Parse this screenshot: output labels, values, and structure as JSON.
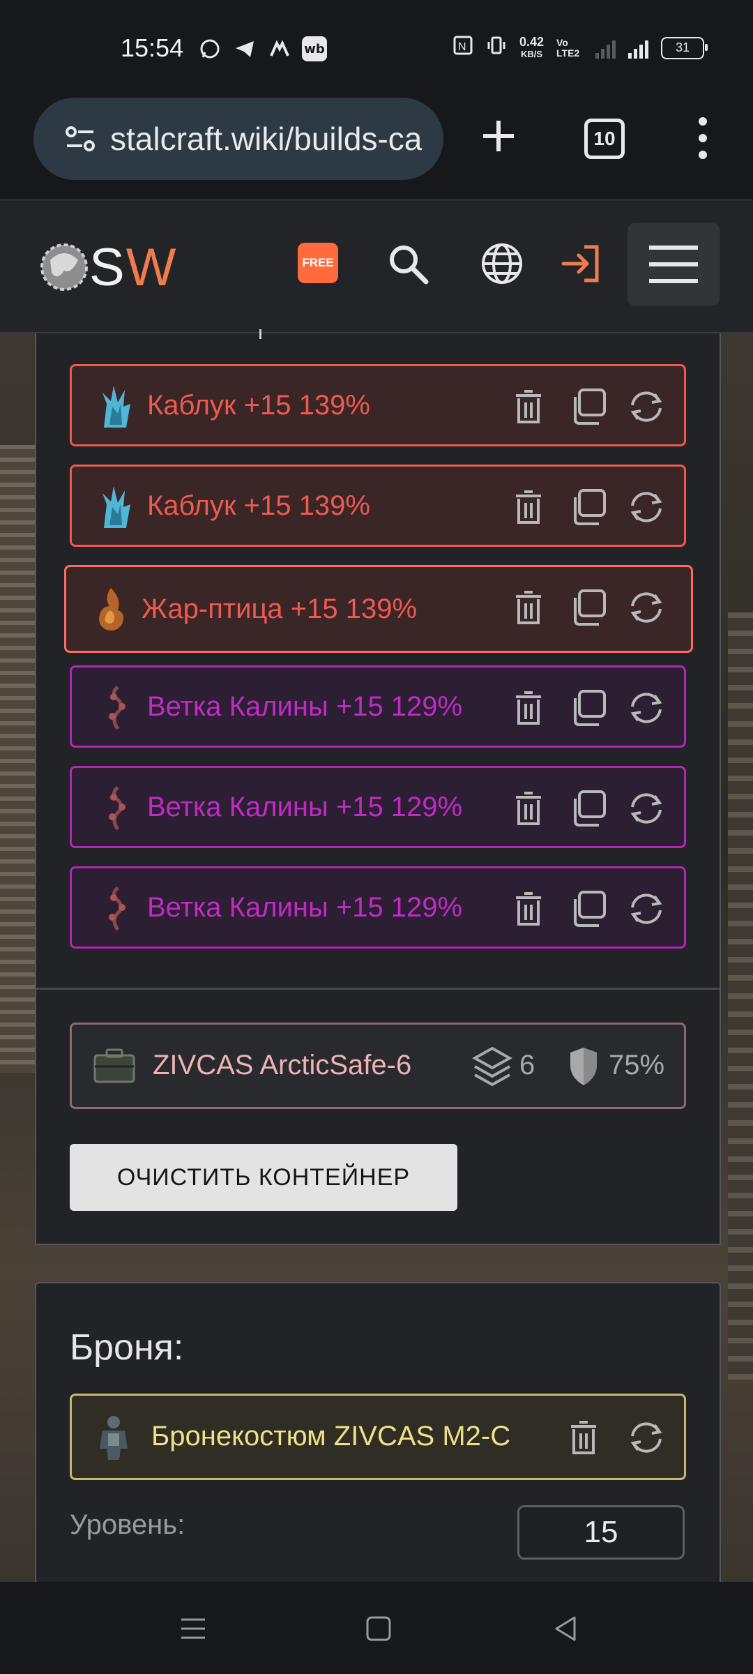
{
  "status_bar": {
    "time": "15:54",
    "apps": [
      "whatsapp-icon",
      "telegram-icon",
      "app-icon",
      "wb"
    ],
    "net_speed_value": "0.42",
    "net_speed_unit": "KB/S",
    "volte": "Vo LTE2",
    "battery": "31"
  },
  "browser": {
    "url": "stalcraft.wiki/builds-ca",
    "tab_count": "10"
  },
  "site": {
    "logo_s": "S",
    "logo_w": "W",
    "free_badge": "FREE"
  },
  "artifacts": [
    {
      "name": "Каблук +15 139%",
      "rarity": "red",
      "icon": "crystal-icon"
    },
    {
      "name": "Каблук +15 139%",
      "rarity": "red",
      "icon": "crystal-icon"
    },
    {
      "name": "Жар-птица +15 139%",
      "rarity": "red",
      "icon": "fire-icon"
    },
    {
      "name": "Ветка Калины +15 129%",
      "rarity": "purple",
      "icon": "branch-icon"
    },
    {
      "name": "Ветка Калины +15 129%",
      "rarity": "purple",
      "icon": "branch-icon"
    },
    {
      "name": "Ветка Калины +15 129%",
      "rarity": "purple",
      "icon": "branch-icon"
    }
  ],
  "container": {
    "name": "ZIVCAS ArcticSafe-6",
    "slots": "6",
    "protection": "75%",
    "clear_button": "ОЧИСТИТЬ КОНТЕЙНЕР"
  },
  "armor": {
    "title": "Броня:",
    "name": "Бронекостюм ZIVCAS M2-C",
    "level_label": "Уровень:",
    "level_value": "15"
  },
  "colors": {
    "accent": "#ff6b3d",
    "legendary": "#ef5a4e",
    "epic": "#c22ac6",
    "armor": "#efe08a"
  }
}
